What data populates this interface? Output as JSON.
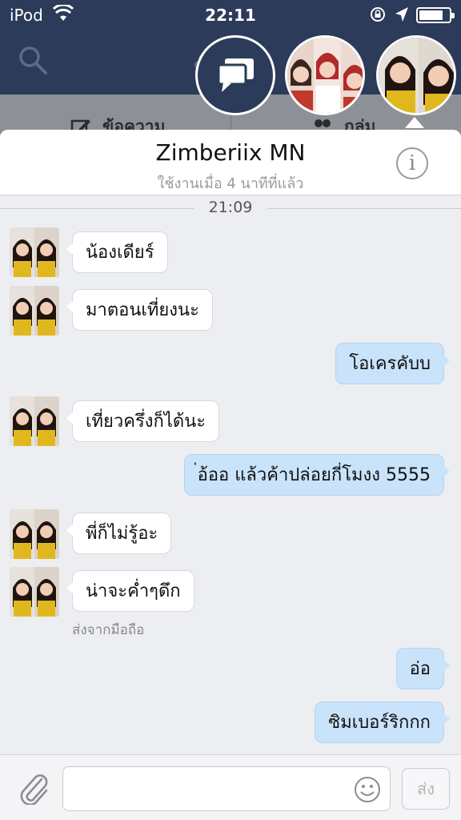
{
  "status_bar": {
    "carrier": "iPod",
    "time": "22:11",
    "battery_fill": 0.8
  },
  "header": {
    "title": "ข้อความ"
  },
  "subtabs": {
    "messages": "ข้อความ",
    "groups": "กลุ่ม"
  },
  "contact": {
    "name": "Zimberiix MN",
    "status": "ใช้งานเมื่อ 4 นาทีที่แล้ว"
  },
  "timestamp": "21:09",
  "messages": [
    {
      "dir": "in",
      "text": "น้องเดียร์"
    },
    {
      "dir": "in",
      "text": "มาตอนเที่ยงนะ"
    },
    {
      "dir": "out",
      "text": "โอเครคับบ"
    },
    {
      "dir": "in",
      "text": "เที่ยวครึ่งก็ได้นะ"
    },
    {
      "dir": "out",
      "text": "่อ้ออ แล้วค้าปล่อยกี่โมงง 5555"
    },
    {
      "dir": "in",
      "text": "พี่ก็ไม่รู้อะ"
    },
    {
      "dir": "in",
      "text": "น่าจะค่ำๆดึก"
    },
    {
      "dir": "out",
      "text": "อ่อ"
    },
    {
      "dir": "out",
      "text": "ซิมเบอร์ริกกก"
    }
  ],
  "sent_from": "ส่งจากมือถือ",
  "input": {
    "value": "",
    "send_label": "ส่ง"
  },
  "colors": {
    "header_bg": "#2b3b59",
    "outgoing_bubble": "#c9e3fb",
    "incoming_bubble": "#ffffff"
  }
}
